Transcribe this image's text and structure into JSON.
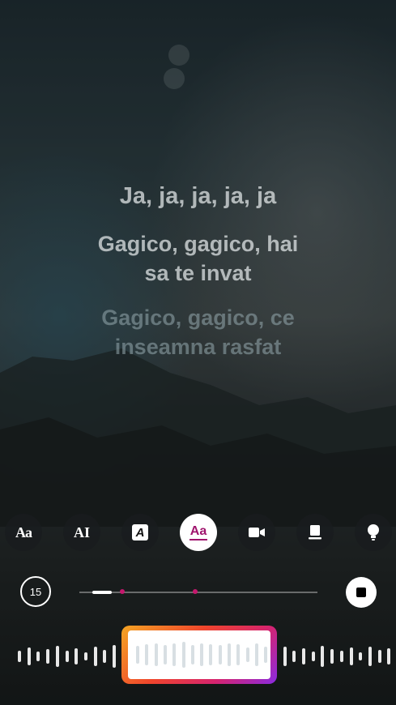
{
  "lyrics": {
    "line1": "Ja, ja, ja, ja, ja",
    "line2a": "Gagico, gagico, hai",
    "line2b": "sa te invat",
    "line3a": "Gagico, gagico, ce",
    "line3b": "inseamna rasfat"
  },
  "style_options": [
    {
      "name": "typewriter-style",
      "glyph": "Aa"
    },
    {
      "name": "bold-style",
      "glyph": "AI"
    },
    {
      "name": "box-style",
      "glyph": "A"
    },
    {
      "name": "karaoke-style",
      "glyph": "Aa"
    },
    {
      "name": "video-icon",
      "glyph": ""
    },
    {
      "name": "card-icon",
      "glyph": ""
    },
    {
      "name": "bulb-icon",
      "glyph": ""
    }
  ],
  "duration_label": "15",
  "playback": {
    "progress": 0.12
  },
  "colors": {
    "accent": "#a0156e",
    "marker": "#c5186d"
  }
}
